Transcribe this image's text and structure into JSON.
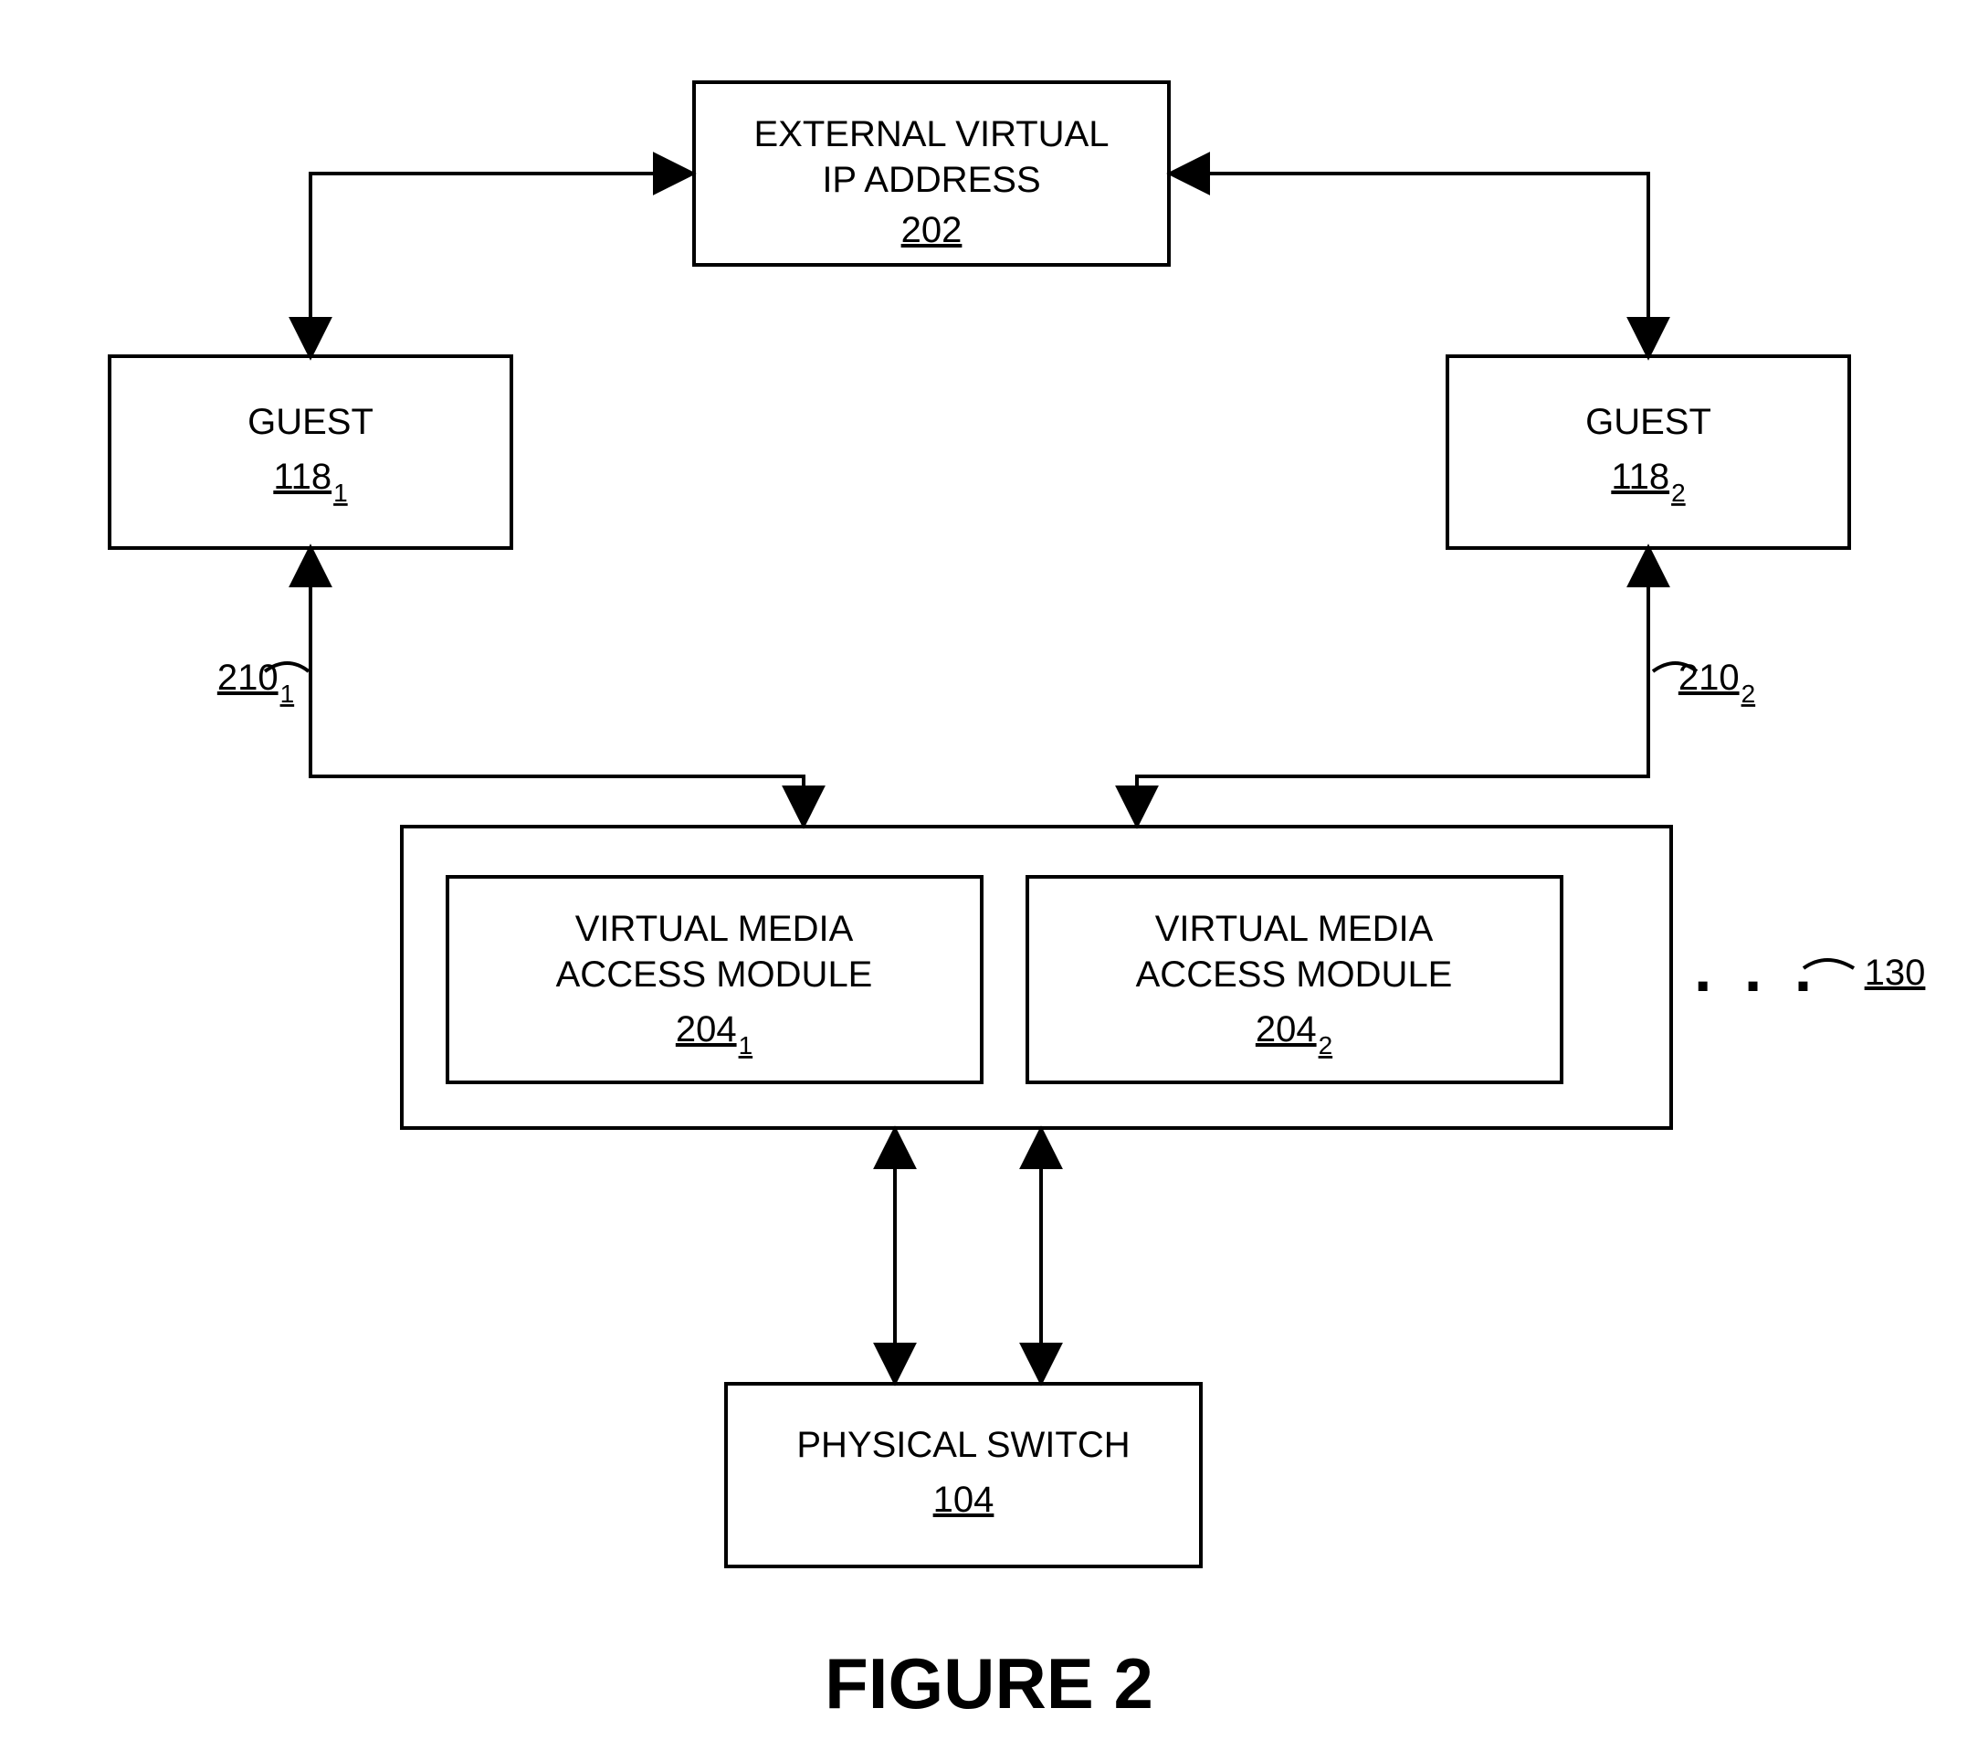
{
  "figure_label": "FIGURE 2",
  "blocks": {
    "ext_ip": {
      "line1": "EXTERNAL VIRTUAL",
      "line2": "IP ADDRESS",
      "ref": "202"
    },
    "guest1": {
      "label": "GUEST",
      "ref_base": "118",
      "ref_sub": "1"
    },
    "guest2": {
      "label": "GUEST",
      "ref_base": "118",
      "ref_sub": "2"
    },
    "vmam1": {
      "line1": "VIRTUAL MEDIA",
      "line2": "ACCESS MODULE",
      "ref_base": "204",
      "ref_sub": "1"
    },
    "vmam2": {
      "line1": "VIRTUAL MEDIA",
      "line2": "ACCESS MODULE",
      "ref_base": "204",
      "ref_sub": "2"
    },
    "pswitch": {
      "label": "PHYSICAL SWITCH",
      "ref": "104"
    }
  },
  "edge_labels": {
    "e1": {
      "ref_base": "210",
      "ref_sub": "1"
    },
    "e2": {
      "ref_base": "210",
      "ref_sub": "2"
    }
  },
  "container_ref": "130",
  "ellipsis": ". . ."
}
